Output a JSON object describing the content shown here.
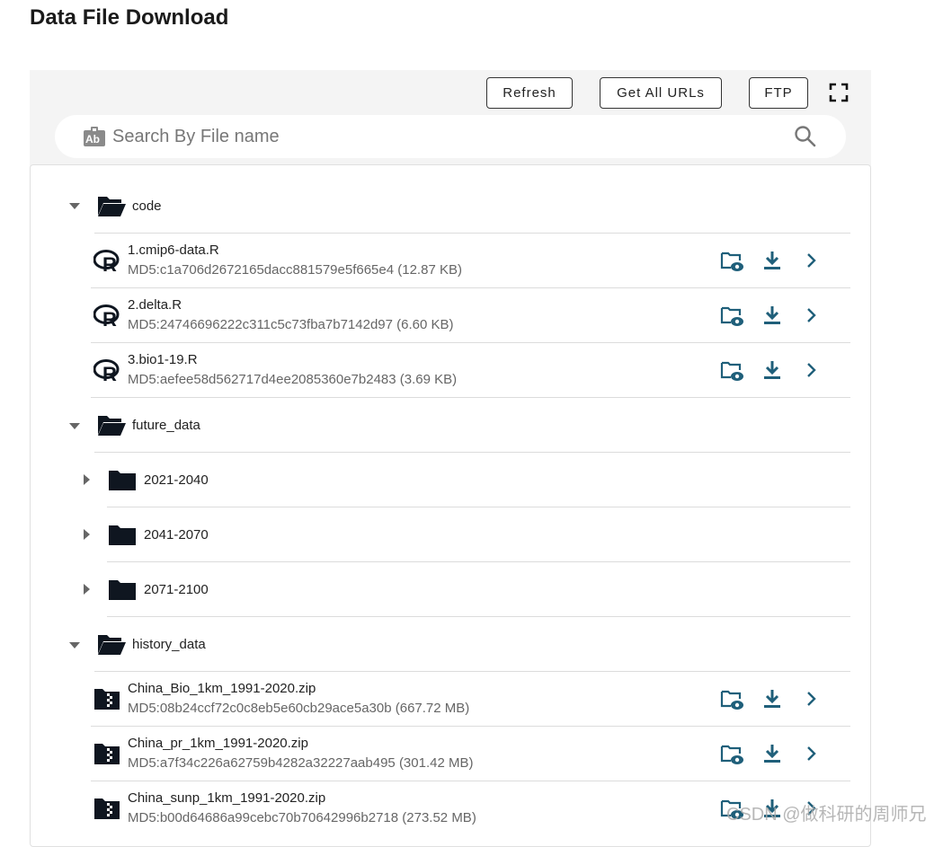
{
  "page": {
    "title": "Data File Download"
  },
  "toolbar": {
    "refresh_label": "Refresh",
    "get_all_urls_label": "Get All URLs",
    "ftp_label": "FTP"
  },
  "search": {
    "placeholder": "Search By File name",
    "value": ""
  },
  "folders": [
    {
      "name": "code",
      "expanded": true,
      "files": [
        {
          "name": "1.cmip6-data.R",
          "meta": "MD5:c1a706d2672165dacc881579e5f665e4 (12.87 KB)",
          "icon": "r-language-icon"
        },
        {
          "name": "2.delta.R",
          "meta": "MD5:24746696222c311c5c73fba7b7142d97 (6.60 KB)",
          "icon": "r-language-icon"
        },
        {
          "name": "3.bio1-19.R",
          "meta": "MD5:aefee58d562717d4ee2085360e7b2483 (3.69 KB)",
          "icon": "r-language-icon"
        }
      ]
    },
    {
      "name": "future_data",
      "expanded": true,
      "subfolders": [
        {
          "name": "2021-2040",
          "expanded": false
        },
        {
          "name": "2041-2070",
          "expanded": false
        },
        {
          "name": "2071-2100",
          "expanded": false
        }
      ]
    },
    {
      "name": "history_data",
      "expanded": true,
      "files": [
        {
          "name": "China_Bio_1km_1991-2020.zip",
          "meta": "MD5:08b24ccf72c0c8eb5e60cb29ace5a30b (667.72 MB)",
          "icon": "zip-file-icon"
        },
        {
          "name": "China_pr_1km_1991-2020.zip",
          "meta": "MD5:a7f34c226a62759b4282a32227aab495 (301.42 MB)",
          "icon": "zip-file-icon"
        },
        {
          "name": "China_sunp_1km_1991-2020.zip",
          "meta": "MD5:b00d64686a99cebc70b70642996b2718 (273.52 MB)",
          "icon": "zip-file-icon"
        }
      ]
    }
  ],
  "watermark": "CSDN @做科研的周师兄",
  "colors": {
    "action_icon": "#1f5f7a",
    "folder_icon": "#0f1620",
    "accent_text": "#222222"
  }
}
